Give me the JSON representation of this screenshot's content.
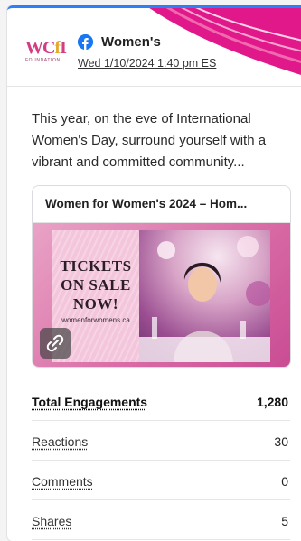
{
  "post": {
    "page_name": "Women's",
    "date": "Wed 1/10/2024 1:40 pm ES",
    "text": "This year, on the eve of International Women's Day, surround yourself with a vibrant and committed community...",
    "logo_text": "WCfI",
    "logo_subtext": "FOUNDATION"
  },
  "link_preview": {
    "title": "Women for Women's 2024 – Hom...",
    "poster_lines": [
      "TICKETS",
      "ON SALE",
      "NOW!"
    ],
    "poster_url": "womenforwomens.ca"
  },
  "metrics": {
    "total": {
      "label": "Total Engagements",
      "value": "1,280"
    },
    "reactions": {
      "label": "Reactions",
      "value": "30"
    },
    "comments": {
      "label": "Comments",
      "value": "0"
    },
    "shares": {
      "label": "Shares",
      "value": "5"
    }
  },
  "colors": {
    "accent_blue": "#2d7ff9",
    "facebook_blue": "#1877f2",
    "pink": "#e0188a"
  },
  "icons": {
    "network": "facebook-icon",
    "link": "link-icon"
  }
}
